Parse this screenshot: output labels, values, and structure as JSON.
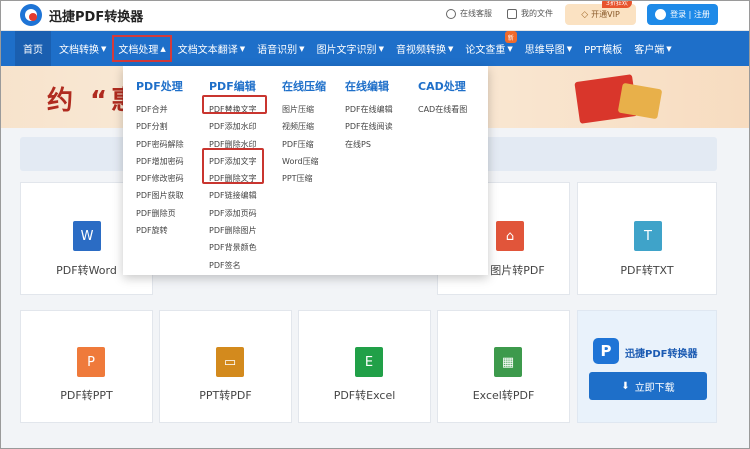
{
  "header": {
    "logo_text": "迅捷PDF转换器",
    "service": "在线客服",
    "my_files": "我的文件",
    "vip_label": "开通VIP",
    "vip_badge": "3折狂欢",
    "login": "登录 | 注册"
  },
  "nav": {
    "items": [
      {
        "label": "首页"
      },
      {
        "label": "文档转换"
      },
      {
        "label": "文档处理"
      },
      {
        "label": "文档文本翻译"
      },
      {
        "label": "语音识别"
      },
      {
        "label": "图片文字识别"
      },
      {
        "label": "音视频转换"
      },
      {
        "label": "论文查重"
      },
      {
        "label": "思维导图"
      },
      {
        "label": "PPT模板"
      },
      {
        "label": "客户端"
      }
    ],
    "new_badge": "新"
  },
  "banner": {
    "text": "约 “惠"
  },
  "dropdown": {
    "columns": [
      {
        "title": "PDF处理",
        "items": [
          "PDF合并",
          "PDF分割",
          "PDF密码解除",
          "PDF增加密码",
          "PDF修改密码",
          "PDF图片获取",
          "PDF删除页",
          "PDF旋转"
        ]
      },
      {
        "title": "PDF编辑",
        "items": [
          "PDF替换文字",
          "PDF添加水印",
          "PDF删除水印",
          "PDF添加文字",
          "PDF删除文字",
          "PDF链接编辑",
          "PDF添加页码",
          "PDF删除图片",
          "PDF背景颜色",
          "PDF签名"
        ]
      },
      {
        "title": "在线压缩",
        "items": [
          "图片压缩",
          "视频压缩",
          "PDF压缩",
          "Word压缩",
          "PPT压缩"
        ]
      },
      {
        "title": "在线编辑",
        "items": [
          "PDF在线编辑",
          "PDF在线阅读",
          "在线PS"
        ]
      },
      {
        "title": "CAD处理",
        "items": [
          "CAD在线看图"
        ]
      }
    ]
  },
  "cards": [
    {
      "label": "PDF转Word",
      "glyph": "W",
      "color": "#2b6cc4"
    },
    {
      "label": "图片转PDF",
      "glyph": "",
      "color": "#e1553a"
    },
    {
      "label": "PDF转TXT",
      "glyph": "T",
      "color": "#3fa3c9"
    },
    {
      "label": "PDF转PPT",
      "glyph": "P",
      "color": "#ef7a3b"
    },
    {
      "label": "PPT转PDF",
      "glyph": "",
      "color": "#d38a1d"
    },
    {
      "label": "PDF转Excel",
      "glyph": "E",
      "color": "#21a048"
    },
    {
      "label": "Excel转PDF",
      "glyph": "",
      "color": "#3d9a4c"
    }
  ],
  "promo": {
    "title": "迅捷PDF转换器",
    "download": "立即下载"
  },
  "colors": {
    "nav_bg": "#1e6fc9",
    "highlight": "#c9352f"
  }
}
